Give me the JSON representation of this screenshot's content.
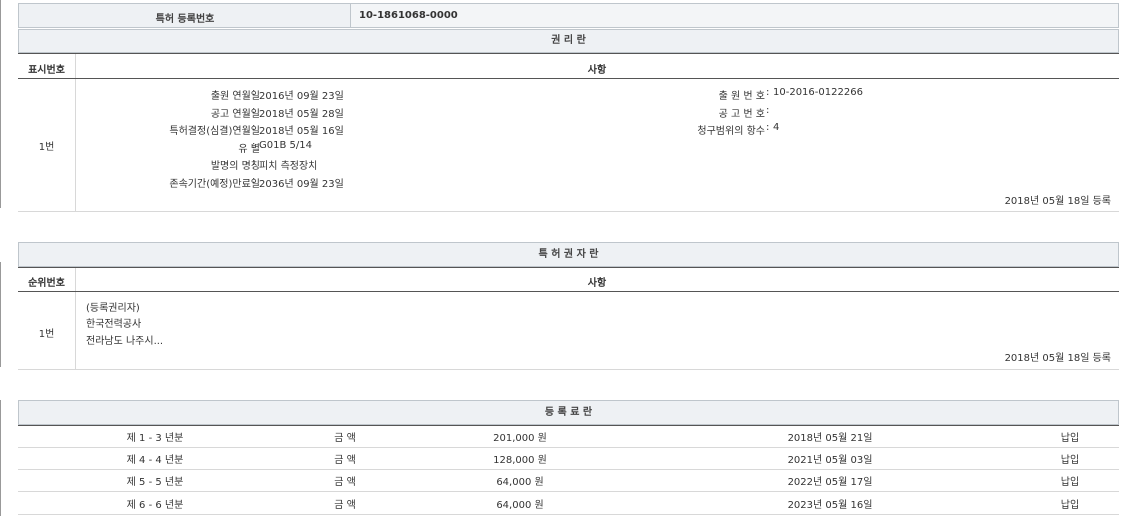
{
  "top": {
    "label": "특허 등록번호",
    "value": "10-1861068-0000"
  },
  "rights": {
    "title": "권 리 란",
    "col_no": "표시번호",
    "col_content": "사항",
    "row_no": "1번",
    "left": [
      {
        "k": "출원 연월일",
        "v": "2016년 09월 23일"
      },
      {
        "k": "공고 연월일",
        "v": "2018년 05월 28일"
      },
      {
        "k": "특허결정(심결)연월일",
        "v": "2018년 05월 16일"
      },
      {
        "k": "유 별",
        "v": "G01B 5/14"
      },
      {
        "k": "발명의 명칭",
        "v": "피치 측정장치"
      },
      {
        "k": "존속기간(예정)만료일",
        "v": "2036년 09월 23일"
      }
    ],
    "right": [
      {
        "k": "출 원 번 호",
        "v": "10-2016-0122266"
      },
      {
        "k": "공 고 번 호",
        "v": ""
      },
      {
        "k": "청구범위의 항수",
        "v": "4"
      }
    ],
    "reg_date": "2018년 05월 18일 등록"
  },
  "holders": {
    "title": "특 허 권 자 란",
    "col_no": "순위번호",
    "col_content": "사항",
    "row_no": "1번",
    "lines": [
      "(등록권리자)",
      "한국전력공사",
      "전라남도 나주시..."
    ],
    "reg_date": "2018년 05월 18일 등록"
  },
  "fees": {
    "title": "등 록 료 란",
    "rows": [
      {
        "period": "제 1 - 3 년분",
        "label": "금 액",
        "amount": "201,000 원",
        "date": "2018년 05월 21일",
        "status": "납입"
      },
      {
        "period": "제 4 - 4 년분",
        "label": "금 액",
        "amount": "128,000 원",
        "date": "2021년 05월 03일",
        "status": "납입"
      },
      {
        "period": "제 5 - 5 년분",
        "label": "금 액",
        "amount": "64,000 원",
        "date": "2022년 05월 17일",
        "status": "납입"
      },
      {
        "period": "제 6 - 6 년분",
        "label": "금 액",
        "amount": "64,000 원",
        "date": "2023년 05월 16일",
        "status": "납입"
      }
    ]
  }
}
